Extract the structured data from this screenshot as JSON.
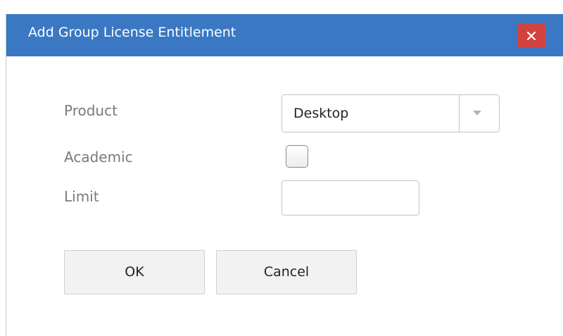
{
  "dialog": {
    "title": "Add Group License Entitlement",
    "close_glyph": "×"
  },
  "form": {
    "product_label": "Product",
    "product_value": "Desktop",
    "academic_label": "Academic",
    "academic_checked": false,
    "limit_label": "Limit",
    "limit_value": ""
  },
  "buttons": {
    "ok_label": "OK",
    "cancel_label": "Cancel"
  },
  "icons": {
    "close": "close-icon",
    "dropdown": "chevron-down-icon"
  },
  "colors": {
    "titlebar": "#3a78c3",
    "close_button": "#d2423f",
    "label_text": "#7a7a7a"
  }
}
